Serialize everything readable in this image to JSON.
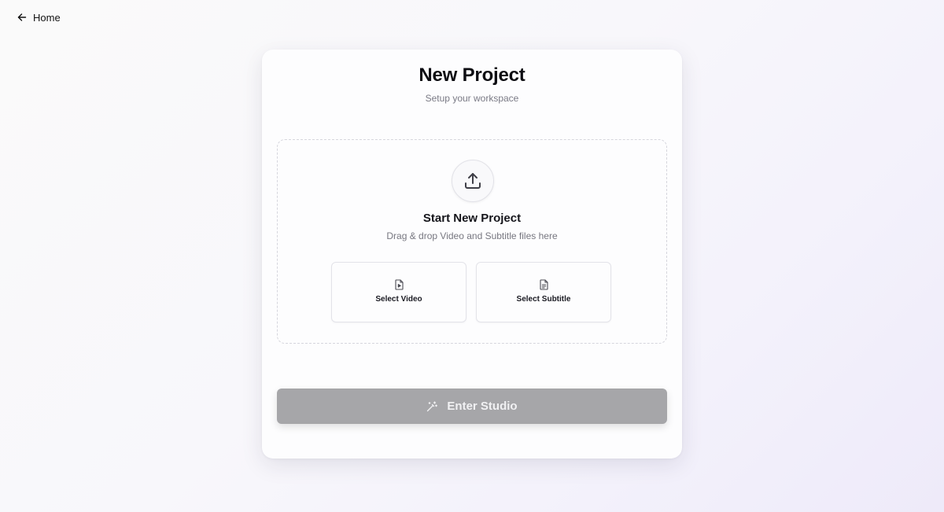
{
  "nav": {
    "back_label": "Home",
    "back_icon": "arrow-left-icon"
  },
  "card": {
    "title": "New Project",
    "subtitle": "Setup your workspace"
  },
  "dropzone": {
    "icon": "upload-icon",
    "title": "Start New Project",
    "subtitle": "Drag & drop Video and Subtitle files here",
    "buttons": [
      {
        "label": "Select Video",
        "icon": "file-video-icon"
      },
      {
        "label": "Select Subtitle",
        "icon": "file-text-icon"
      }
    ]
  },
  "primary_action": {
    "label": "Enter Studio",
    "icon": "magic-wand-icon",
    "state": "disabled"
  },
  "colors": {
    "primary_disabled": "#a6a6a9",
    "card_bg": "#fdfdfe",
    "dropzone_border": "#d6d6dd"
  }
}
